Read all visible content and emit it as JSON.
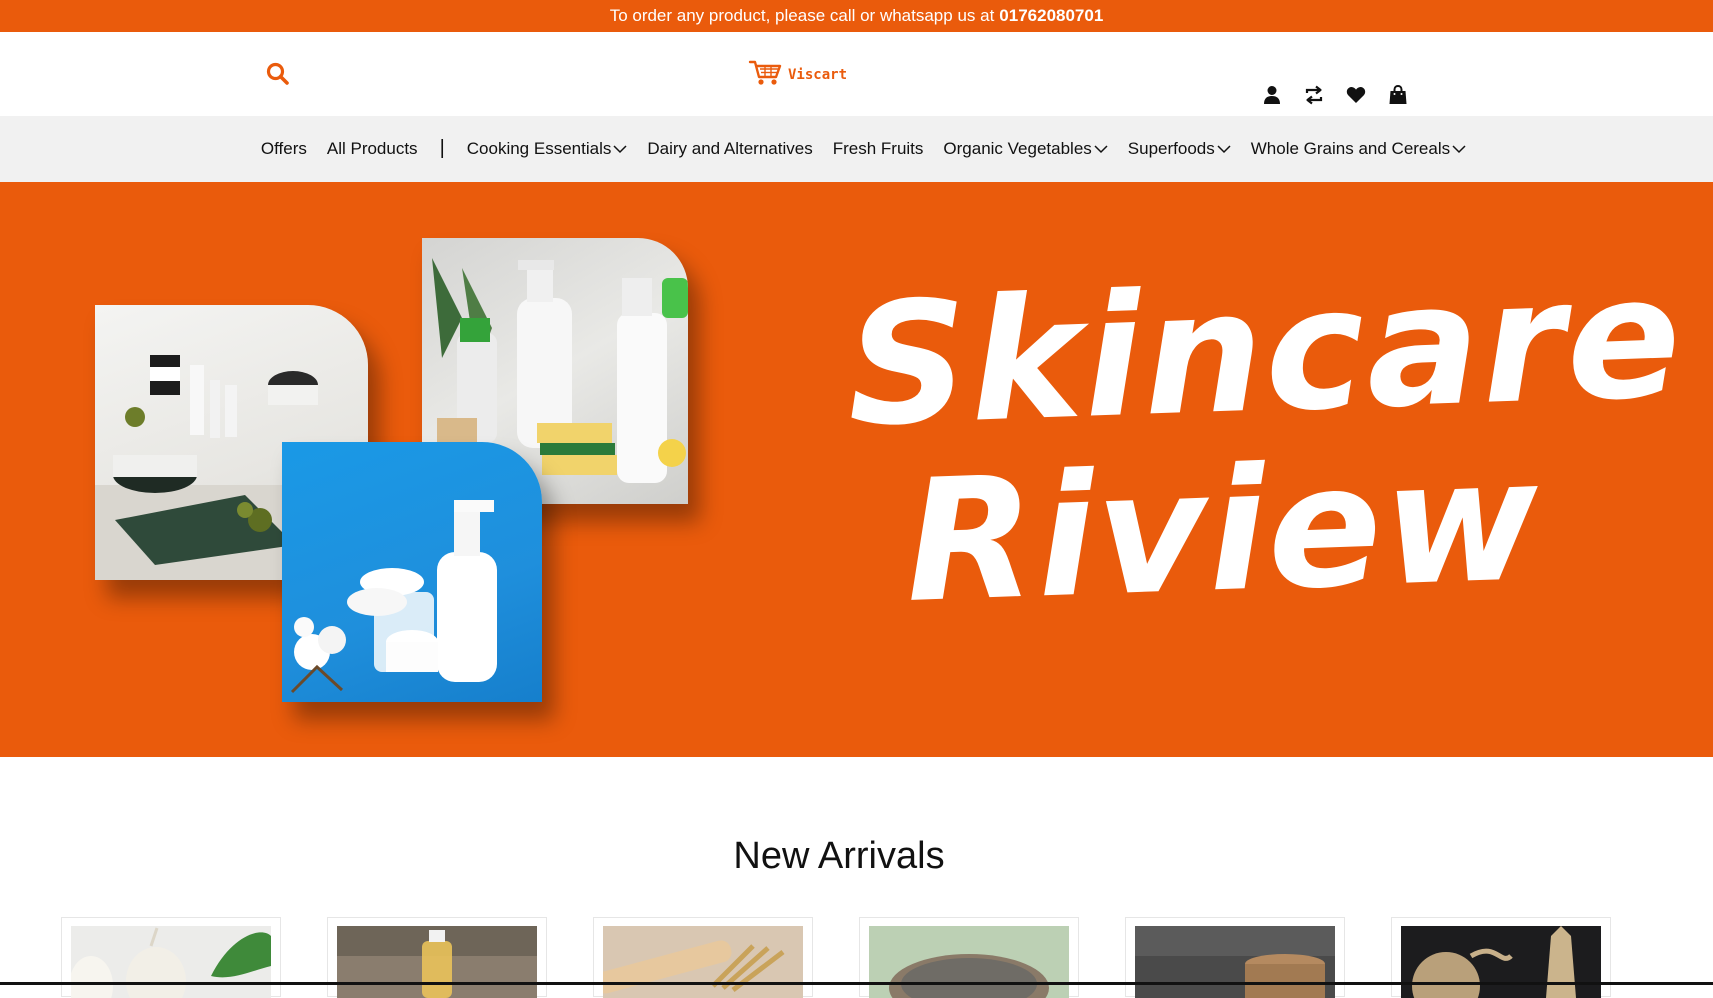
{
  "announcement": {
    "text": "To order any product, please call or whatsapp us at",
    "phone": "01762080701"
  },
  "header": {
    "logo_text": "Viscart",
    "icons": [
      "search-icon",
      "user-icon",
      "compare-icon",
      "heart-icon",
      "shopping-bag-icon"
    ]
  },
  "nav": {
    "items": [
      {
        "label": "Offers",
        "has_dropdown": false
      },
      {
        "label": "All Products",
        "has_dropdown": false
      },
      {
        "label": "Cooking Essentials",
        "has_dropdown": true
      },
      {
        "label": "Dairy and Alternatives",
        "has_dropdown": false
      },
      {
        "label": "Fresh Fruits",
        "has_dropdown": false
      },
      {
        "label": "Organic Vegetables",
        "has_dropdown": true
      },
      {
        "label": "Superfoods",
        "has_dropdown": true
      },
      {
        "label": "Whole Grains and Cereals",
        "has_dropdown": true
      }
    ],
    "separator": "|"
  },
  "hero": {
    "title_line1": "Skincare",
    "title_line2": "Riview",
    "background": "#ea5b0c"
  },
  "new_arrivals": {
    "title": "New Arrivals",
    "products": [
      {
        "image": "garlic"
      },
      {
        "image": "oil-bottle"
      },
      {
        "image": "wheat-rolling-pin"
      },
      {
        "image": "chia-seeds"
      },
      {
        "image": "dark-bowl"
      },
      {
        "image": "brass-jugs"
      }
    ]
  },
  "colors": {
    "brand": "#ea5b0c",
    "nav_bg": "#f1f1f1"
  }
}
